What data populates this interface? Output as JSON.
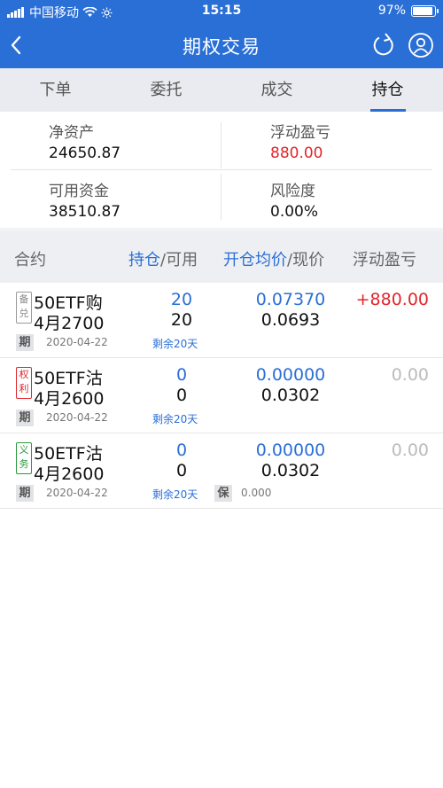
{
  "status_bar": {
    "carrier": "中国移动",
    "time": "15:15",
    "battery": "97%"
  },
  "nav": {
    "title": "期权交易"
  },
  "tabs": [
    {
      "label": "下单"
    },
    {
      "label": "委托"
    },
    {
      "label": "成交"
    },
    {
      "label": "持仓",
      "active": true
    }
  ],
  "summary": {
    "net_assets_label": "净资产",
    "net_assets": "24650.87",
    "floating_pl_label": "浮动盈亏",
    "floating_pl": "880.00",
    "available_funds_label": "可用资金",
    "available_funds": "38510.87",
    "risk_label": "风险度",
    "risk": "0.00%"
  },
  "table_header": {
    "contract": "合约",
    "position": "持仓",
    "slash1": "/",
    "available": "可用",
    "open_avg": "开仓均价",
    "slash2": "/",
    "current_price": "现价",
    "floating_pl": "浮动盈亏"
  },
  "positions": [
    {
      "badge_top": "备",
      "badge_bottom": "兑",
      "name_line1": "50ETF购",
      "name_line2": "4月2700",
      "position": "20",
      "available": "20",
      "open_avg": "0.07370",
      "current": "0.0693",
      "pl": "+880.00",
      "tag": "期",
      "date": "2020-04-22",
      "remaining": "剩余20天"
    },
    {
      "badge_top": "权",
      "badge_bottom": "利",
      "name_line1": "50ETF沽",
      "name_line2": "4月2600",
      "position": "0",
      "available": "0",
      "open_avg": "0.00000",
      "current": "0.0302",
      "pl": "0.00",
      "tag": "期",
      "date": "2020-04-22",
      "remaining": "剩余20天"
    },
    {
      "badge_top": "义",
      "badge_bottom": "务",
      "name_line1": "50ETF沽",
      "name_line2": "4月2600",
      "position": "0",
      "available": "0",
      "open_avg": "0.00000",
      "current": "0.0302",
      "pl": "0.00",
      "tag": "期",
      "date": "2020-04-22",
      "remaining": "剩余20天",
      "margin_tag": "保",
      "margin": "0.000"
    }
  ]
}
